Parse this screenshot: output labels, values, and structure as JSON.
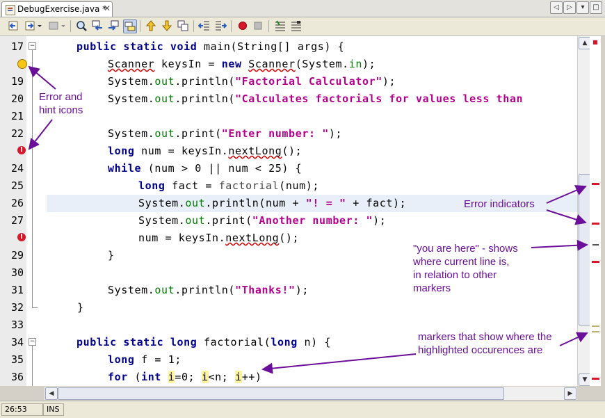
{
  "tab": {
    "title": "DebugExercise.java *",
    "close": "✕"
  },
  "nav_buttons": [
    "◁",
    "▷",
    "▾",
    "□"
  ],
  "toolbar_icons": [
    "go-back-icon",
    "go-forward-icon",
    "last-edit-icon",
    "find-icon",
    "find-previous-icon",
    "find-next-icon",
    "toggle-highlight-icon",
    "previous-bookmark-icon",
    "next-bookmark-icon",
    "toggle-bookmark-icon",
    "shift-left-icon",
    "shift-right-icon",
    "start-macro-icon",
    "stop-macro-icon",
    "comment-icon",
    "uncomment-icon"
  ],
  "lines": [
    {
      "num": "17",
      "gutter": "",
      "fold": "open"
    },
    {
      "num": "",
      "gutter": "hint",
      "fold": ""
    },
    {
      "num": "19",
      "gutter": "",
      "fold": ""
    },
    {
      "num": "20",
      "gutter": "",
      "fold": ""
    },
    {
      "num": "21",
      "gutter": "",
      "fold": ""
    },
    {
      "num": "22",
      "gutter": "",
      "fold": ""
    },
    {
      "num": "",
      "gutter": "error",
      "fold": ""
    },
    {
      "num": "24",
      "gutter": "",
      "fold": ""
    },
    {
      "num": "25",
      "gutter": "",
      "fold": ""
    },
    {
      "num": "26",
      "gutter": "",
      "fold": ""
    },
    {
      "num": "27",
      "gutter": "",
      "fold": ""
    },
    {
      "num": "",
      "gutter": "error",
      "fold": ""
    },
    {
      "num": "29",
      "gutter": "",
      "fold": ""
    },
    {
      "num": "30",
      "gutter": "",
      "fold": ""
    },
    {
      "num": "31",
      "gutter": "",
      "fold": ""
    },
    {
      "num": "32",
      "gutter": "",
      "fold": "end"
    },
    {
      "num": "33",
      "gutter": "",
      "fold": ""
    },
    {
      "num": "34",
      "gutter": "",
      "fold": "open"
    },
    {
      "num": "35",
      "gutter": "",
      "fold": ""
    },
    {
      "num": "36",
      "gutter": "",
      "fold": ""
    }
  ],
  "code": {
    "l17": {
      "kw1": "public static void",
      "name": " main",
      "rest": "(String[] args) {"
    },
    "l18": {
      "t1": "Scanner",
      "t2": " keysIn = ",
      "kw": "new",
      "t3": " ",
      "t4": "Scanner",
      "t5": "(System.",
      "fld": "in",
      "t6": ");"
    },
    "l19": {
      "t1": "System.",
      "fld": "out",
      "t2": ".println(",
      "str": "\"Factorial Calculator\"",
      "t3": ");"
    },
    "l20": {
      "t1": "System.",
      "fld": "out",
      "t2": ".println(",
      "str": "\"Calculates factorials for values less than"
    },
    "l22": {
      "t1": "System.",
      "fld": "out",
      "t2": ".print(",
      "str": "\"Enter number: \"",
      "t3": ");"
    },
    "l23": {
      "kw": "long",
      "t1": " num = keysIn.",
      "m": "nextLong",
      "t2": "();"
    },
    "l24": {
      "kw": "while",
      "t1": " (num > ",
      "n1": "0",
      "t2": " || num < ",
      "n2": "25",
      "t3": ") {"
    },
    "l25": {
      "kw": "long",
      "t1": " fact = ",
      "m": "factorial",
      "t2": "(num);"
    },
    "l26": {
      "t1": "System.",
      "fld": "out",
      "t2": ".println(num + ",
      "str": "\"! = \"",
      "t3": " + fact);"
    },
    "l27": {
      "t1": "System.",
      "fld": "out",
      "t2": ".print(",
      "str": "\"Another number: \"",
      "t3": ");"
    },
    "l28": {
      "t1": "num = keysIn.",
      "m": "nextLong",
      "t2": "();"
    },
    "l29": {
      "t1": "}"
    },
    "l31": {
      "t1": "System.",
      "fld": "out",
      "t2": ".println(",
      "str": "\"Thanks!\"",
      "t3": ");"
    },
    "l32": {
      "t1": "}"
    },
    "l34": {
      "kw1": "public static long",
      "name": " factorial",
      "t1": "(",
      "kw2": "long",
      "t2": " n) {"
    },
    "l35": {
      "kw": "long",
      "t1": " f = ",
      "n": "1",
      "t2": ";"
    },
    "l36": {
      "kw": "for",
      "t1": " (",
      "kw2": "int",
      "t2": " ",
      "i1": "i",
      "t3": "=0; ",
      "i2": "i",
      "t4": "<n; ",
      "i3": "i",
      "t5": "++)"
    }
  },
  "annotations": {
    "error_hint": [
      "Error and",
      "hint icons"
    ],
    "error_indicators": "Error indicators",
    "you_are_here": [
      "\"you are here\" - shows",
      "where current line is,",
      "in relation to other",
      "markers"
    ],
    "markers": [
      "markers that show where the",
      "highlighted occurences are"
    ]
  },
  "status": {
    "position": "26:53",
    "mode": "INS"
  },
  "colors": {
    "annotation": "#6b0f9a",
    "error": "#d7182a",
    "current_line": "#e9eff8",
    "occurrence": "#fff3a0",
    "keyword": "#00008b",
    "string": "#b5008d"
  }
}
